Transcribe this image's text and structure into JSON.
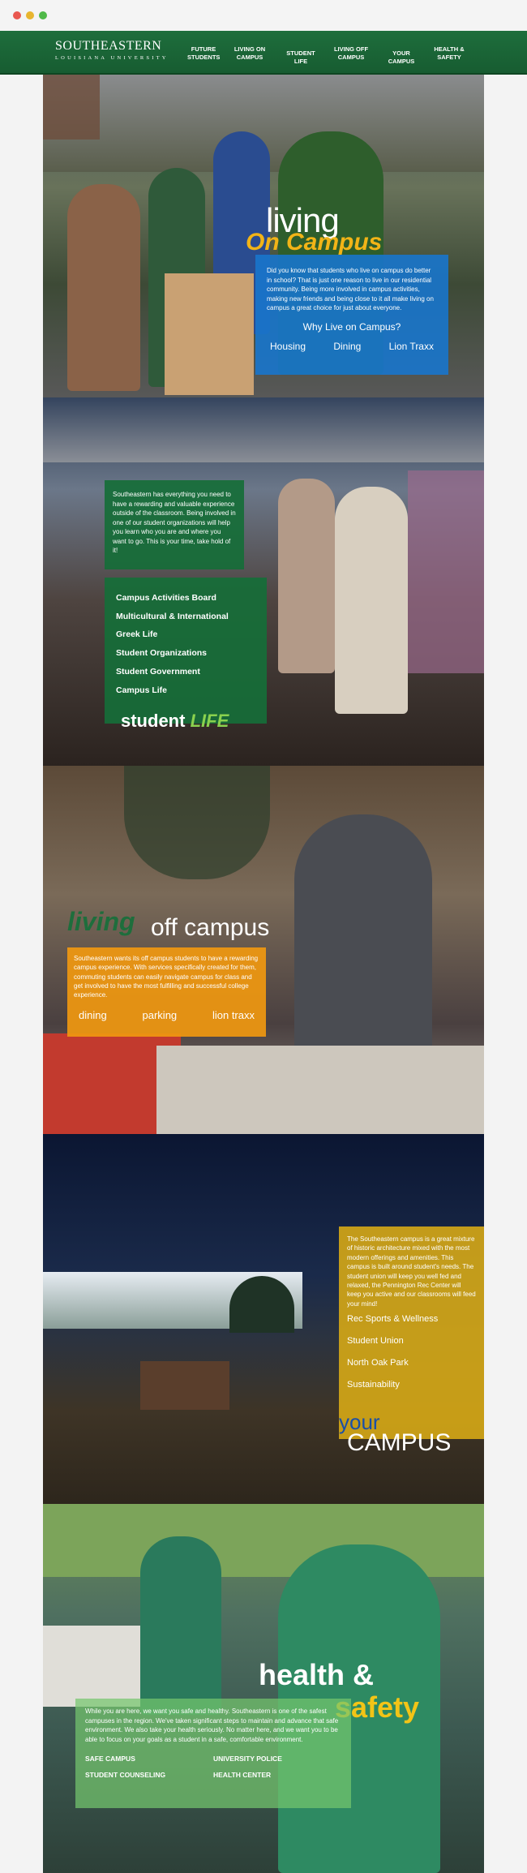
{
  "nav": {
    "logo_main": "SOUTHEASTERN",
    "logo_sub": "LOUISIANA UNIVERSITY",
    "items": [
      {
        "label": "FUTURE\nSTUDENTS"
      },
      {
        "label": "LIVING ON\nCAMPUS"
      },
      {
        "label": "STUDENT LIFE"
      },
      {
        "label": "LIVING OFF\nCAMPUS"
      },
      {
        "label": "YOUR CAMPUS"
      },
      {
        "label": "HEALTH &\nSAFETY"
      }
    ]
  },
  "on_campus": {
    "title_line1": "living",
    "title_line2": "On Campus",
    "body": "Did you know that students who live on campus do better in school? That is just one reason to live in our residential community. Being more involved in campus activities, making new friends and being close to it all make living on campus a great choice for just about everyone.",
    "heading": "Why Live on Campus?",
    "links": [
      "Housing",
      "Dining",
      "Lion Traxx"
    ]
  },
  "student_life": {
    "intro": "Southeastern has everything you need to have a rewarding and valuable experience outside of the classroom. Being involved in one of our student organizations will help you learn who you are and where you want to go. This is your time, take hold of it!",
    "items": [
      "Campus Activities Board",
      "Multicultural & International",
      "Greek Life",
      "Student Organizations",
      "Student Government",
      "Campus Life"
    ],
    "title_a": "student",
    "title_b": "LIFE"
  },
  "off_campus": {
    "title_a": "living",
    "title_b": "off campus",
    "body": "Southeastern wants its off campus students to have a rewarding campus experience. With services specifically created for them, commuting students can easily navigate campus for class and get involved to have the most fulfilling and successful college experience.",
    "links": [
      "dining",
      "parking",
      "lion traxx"
    ]
  },
  "your_campus": {
    "body": "The Southeastern campus is a great mixture of historic architecture mixed with the most modern offerings and amenities. This campus is built around student's needs. The student union will keep you well fed and relaxed, the Pennington Rec Center will keep you active and our classrooms will feed your mind!",
    "items": [
      "Rec Sports & Wellness",
      "Student Union",
      "North Oak Park",
      "Sustainability"
    ],
    "title_a": "your",
    "title_b": "CAMPUS"
  },
  "health_safety": {
    "title_a": "health &",
    "title_b": "safety",
    "body": "While you are here, we want you safe and healthy. Southeastern is one of the safest campuses in the region. We've taken significant steps to maintain and advance that safe environment. We also take your health seriously. No matter here, and we want you to be able to focus on your goals as a student in a safe, comfortable environment.",
    "links": [
      "SAFE CAMPUS",
      "UNIVERSITY POLICE",
      "STUDENT COUNSELING",
      "HEALTH CENTER"
    ]
  }
}
